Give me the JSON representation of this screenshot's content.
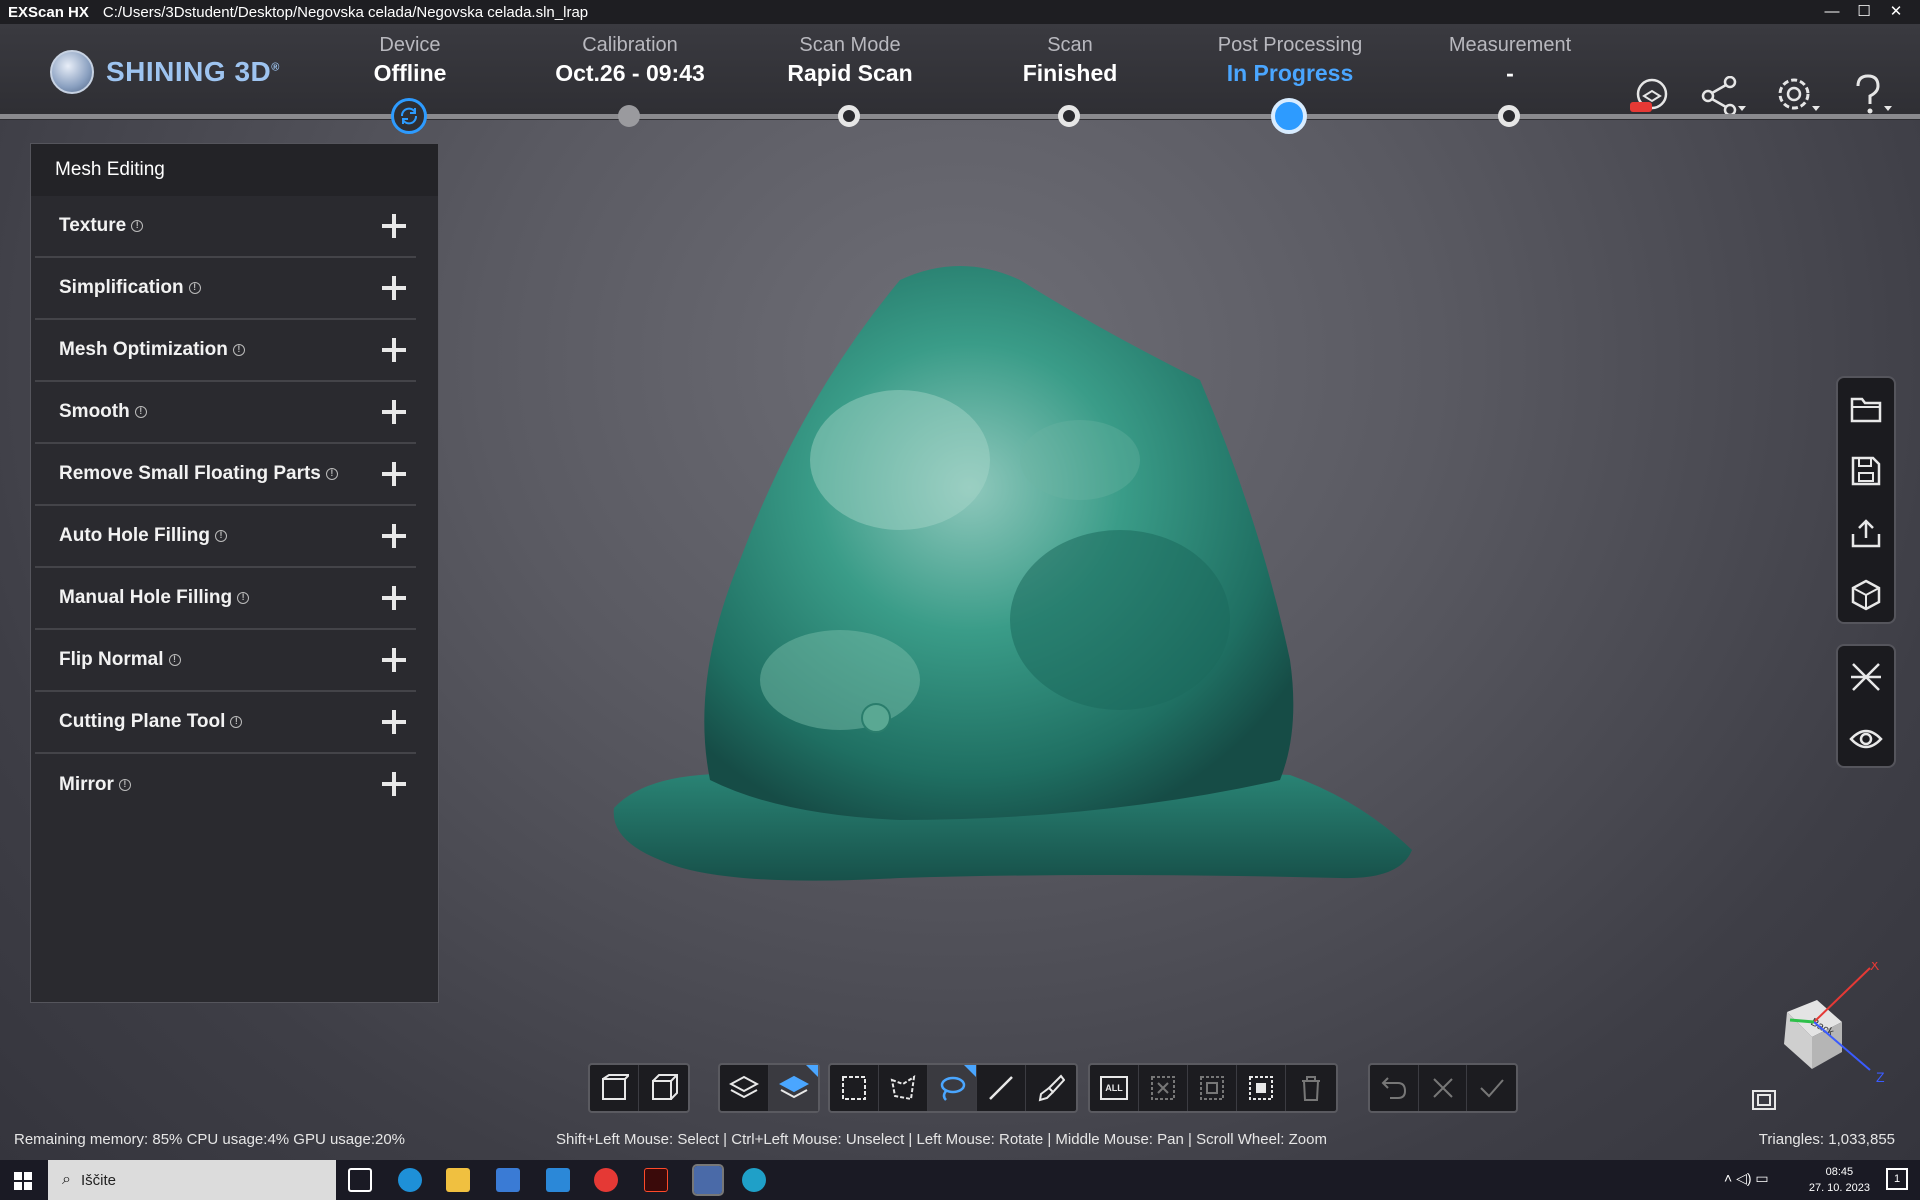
{
  "window": {
    "app_name": "EXScan HX",
    "file_path": "C:/Users/3Dstudent/Desktop/Negovska celada/Negovska celada.sln_lrap",
    "controls": [
      "—",
      "☐",
      "✕"
    ]
  },
  "logo": {
    "text": "SHINING 3D",
    "mark": "®"
  },
  "steps": [
    {
      "label": "Device",
      "value": "Offline"
    },
    {
      "label": "Calibration",
      "value": "Oct.26 - 09:43"
    },
    {
      "label": "Scan Mode",
      "value": "Rapid Scan"
    },
    {
      "label": "Scan",
      "value": "Finished"
    },
    {
      "label": "Post Processing",
      "value": "In Progress"
    },
    {
      "label": "Measurement",
      "value": "-"
    }
  ],
  "header_icons": [
    "new-model-icon",
    "share-icon",
    "settings-icon",
    "help-icon"
  ],
  "panel": {
    "title": "Mesh Editing",
    "items": [
      {
        "label": "Texture"
      },
      {
        "label": "Simplification"
      },
      {
        "label": "Mesh Optimization"
      },
      {
        "label": "Smooth"
      },
      {
        "label": "Remove Small Floating Parts"
      },
      {
        "label": "Auto Hole Filling"
      },
      {
        "label": "Manual Hole Filling"
      },
      {
        "label": "Flip Normal"
      },
      {
        "label": "Cutting Plane Tool"
      },
      {
        "label": "Mirror"
      }
    ]
  },
  "right_toolbar": {
    "group1": [
      "open-folder-icon",
      "save-icon",
      "export-icon",
      "3d-model-icon"
    ],
    "group2": [
      "align-icon",
      "view-eye-icon"
    ]
  },
  "bottom_toolbar": {
    "select_all_label": "ALL"
  },
  "status": {
    "left": "Remaining memory: 85% CPU usage:4%  GPU usage:20%",
    "center": "Shift+Left Mouse: Select | Ctrl+Left Mouse: Unselect | Left Mouse: Rotate | Middle Mouse: Pan | Scroll Wheel: Zoom",
    "right": "Triangles: 1,033,855"
  },
  "gizmo": {
    "x": "X",
    "z": "Z",
    "face": "Back"
  },
  "taskbar": {
    "search_placeholder": "Iščite",
    "time": "08:45",
    "date": "27. 10. 2023",
    "notifications": "1"
  },
  "colors": {
    "accent": "#2d9bff",
    "in_progress": "#4aa6ff",
    "model_teal": "#2f9a8a"
  }
}
